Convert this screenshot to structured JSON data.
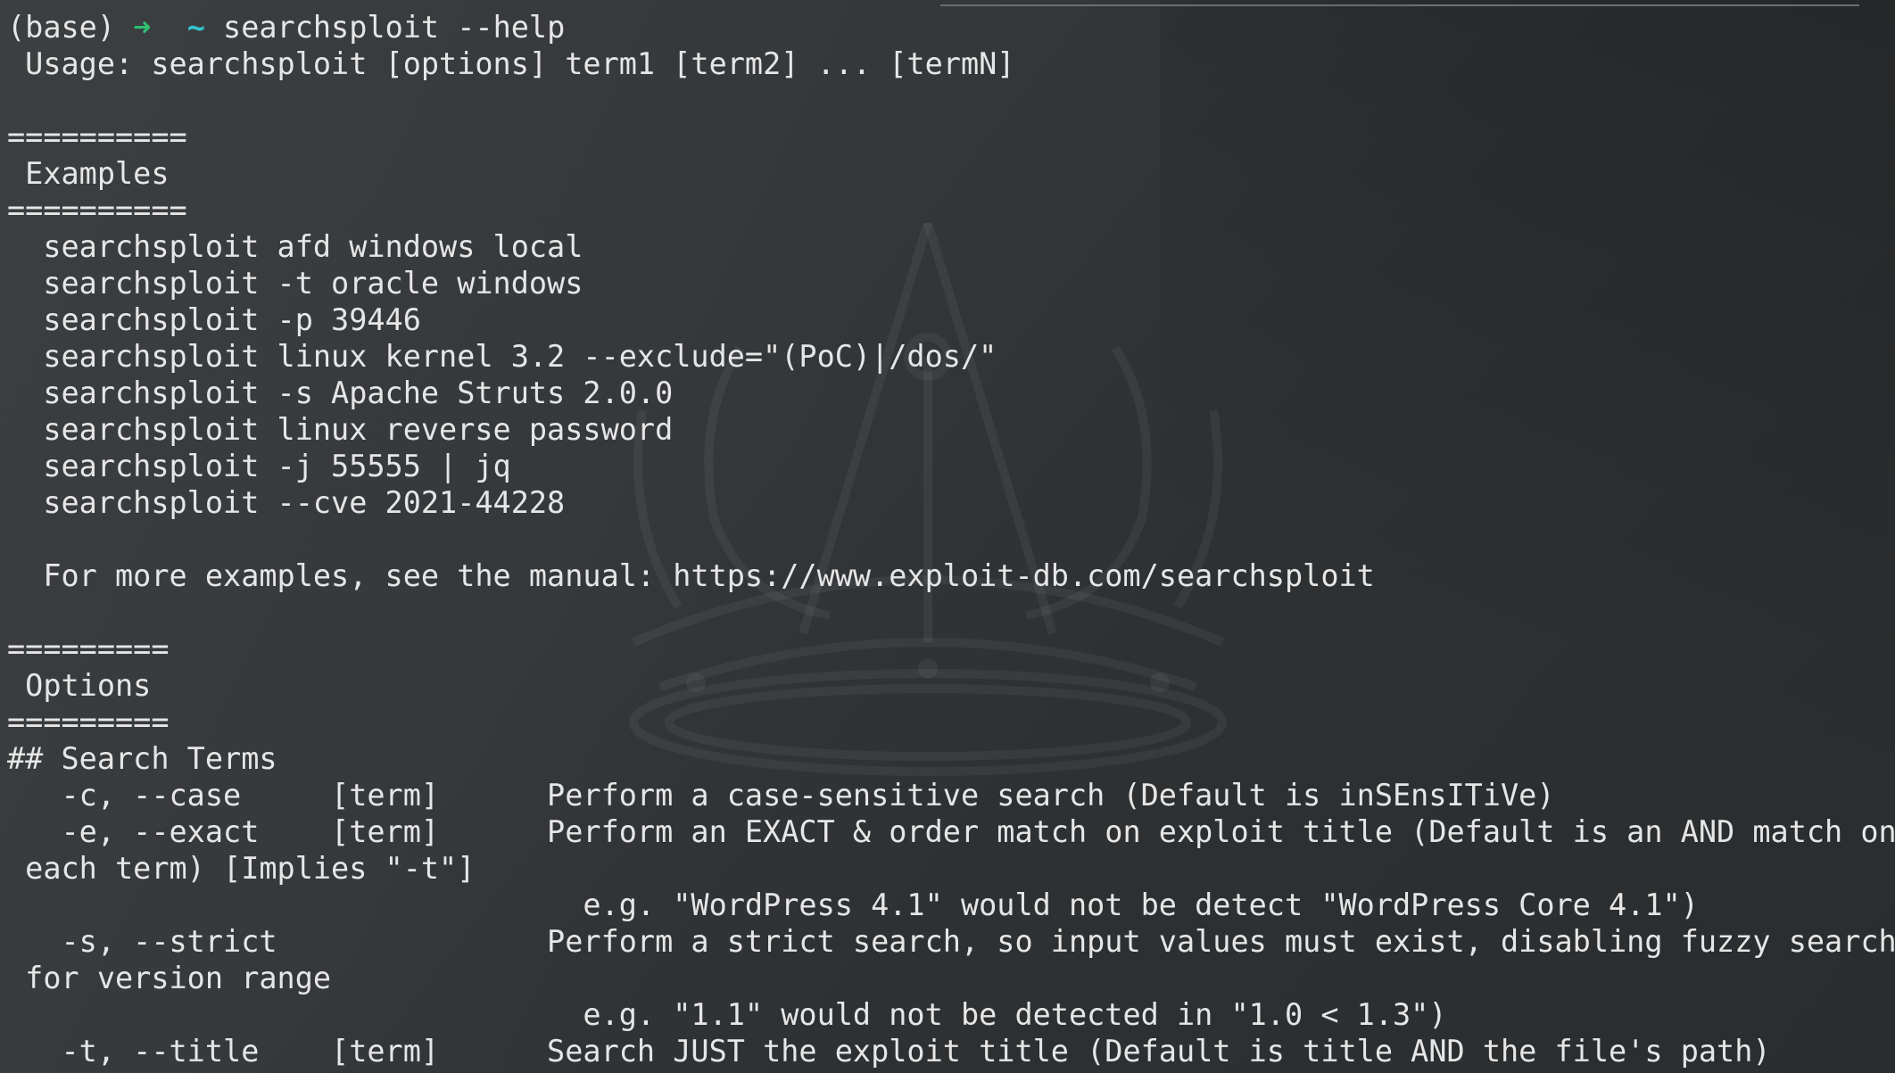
{
  "prompt": {
    "env": "(base)",
    "arrow": "➜",
    "cwd": "~",
    "command": "searchsploit --help"
  },
  "lines": [
    " Usage: searchsploit [options] term1 [term2] ... [termN]",
    "",
    "==========",
    " Examples",
    "==========",
    "  searchsploit afd windows local",
    "  searchsploit -t oracle windows",
    "  searchsploit -p 39446",
    "  searchsploit linux kernel 3.2 --exclude=\"(PoC)|/dos/\"",
    "  searchsploit -s Apache Struts 2.0.0",
    "  searchsploit linux reverse password",
    "  searchsploit -j 55555 | jq",
    "  searchsploit --cve 2021-44228",
    "",
    "  For more examples, see the manual: https://www.exploit-db.com/searchsploit",
    "",
    "=========",
    " Options",
    "=========",
    "## Search Terms",
    "   -c, --case     [term]      Perform a case-sensitive search (Default is inSEnsITiVe)",
    "   -e, --exact    [term]      Perform an EXACT & order match on exploit title (Default is an AND match on",
    " each term) [Implies \"-t\"]",
    "                                e.g. \"WordPress 4.1\" would not be detect \"WordPress Core 4.1\")",
    "   -s, --strict               Perform a strict search, so input values must exist, disabling fuzzy search",
    " for version range",
    "                                e.g. \"1.1\" would not be detected in \"1.0 < 1.3\")",
    "   -t, --title    [term]      Search JUST the exploit title (Default is title AND the file's path)"
  ],
  "colors": {
    "background": "#2f3133",
    "text": "#e6e6e6",
    "prompt_arrow": "#2fbf71",
    "prompt_tilde": "#34c5cf"
  }
}
